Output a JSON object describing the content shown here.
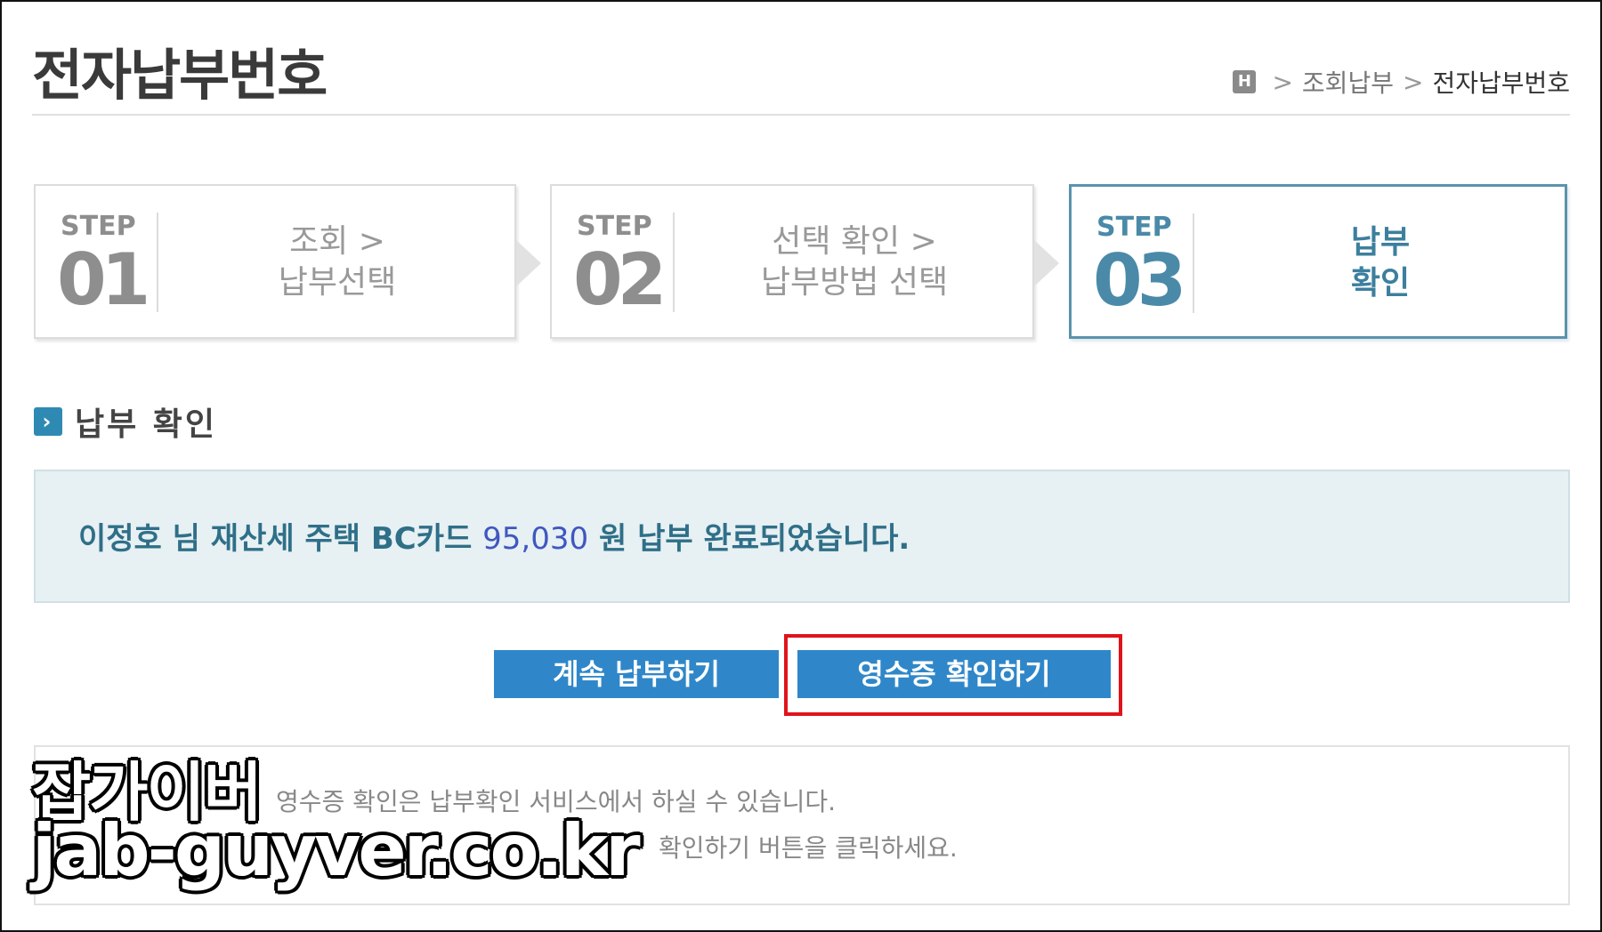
{
  "page_title": "전자납부번호",
  "breadcrumb": {
    "home_icon": "H",
    "items": [
      "조회납부",
      "전자납부번호"
    ],
    "separator": ">"
  },
  "steps": [
    {
      "word": "STEP",
      "number": "01",
      "label_line1": "조회 >",
      "label_line2": "납부선택",
      "active": false
    },
    {
      "word": "STEP",
      "number": "02",
      "label_line1": "선택 확인 >",
      "label_line2": "납부방법 선택",
      "active": false
    },
    {
      "word": "STEP",
      "number": "03",
      "label_line1": "납부",
      "label_line2": "확인",
      "active": true
    }
  ],
  "section": {
    "title": "납부 확인",
    "icon": "chevron-right-icon"
  },
  "result": {
    "prefix": "이정호 님 재산세 주택 BC카드",
    "amount": "95,030",
    "suffix": "원 납부 완료되었습니다."
  },
  "buttons": {
    "continue_label": "계속 납부하기",
    "receipt_label": "영수증 확인하기"
  },
  "notes": {
    "line1": "영수증 확인은 납부확인 서비스에서 하실 수 있습니다.",
    "line2": "확인하기 버튼을 클릭하세요."
  },
  "watermark": {
    "line1": "잡가이버",
    "line2": "jab-guyver.co.kr"
  },
  "colors": {
    "accent": "#2f87c9",
    "highlight": "#e0131a",
    "active_step": "#4a8aa8",
    "result_bg": "#e7f0f3"
  }
}
